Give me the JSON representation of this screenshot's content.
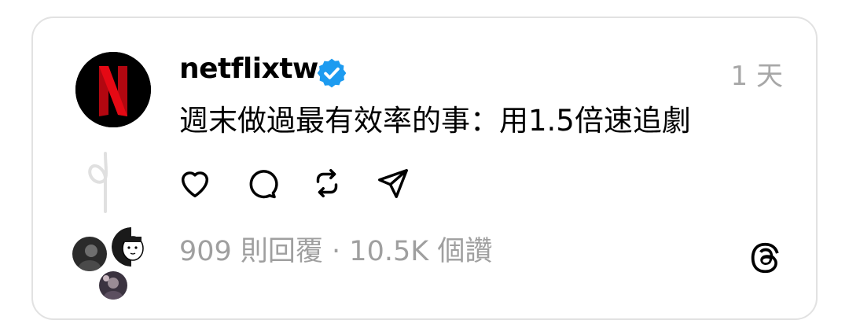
{
  "post": {
    "username": "netflixtw",
    "time": "1 天",
    "text": "週末做過最有效率的事：用1.5倍速追劇",
    "stats": "909 則回覆 · 10.5K 個讚"
  },
  "icons": {
    "avatar": "netflix-logo",
    "verified": "verified-badge-icon",
    "actions": [
      "heart-icon",
      "comment-icon",
      "repost-icon",
      "send-icon"
    ],
    "brand": "threads-logo-icon"
  },
  "colors": {
    "netflix_red": "#e50914",
    "verified_blue": "#1d9bf0",
    "muted_text": "#9f9f9f"
  }
}
